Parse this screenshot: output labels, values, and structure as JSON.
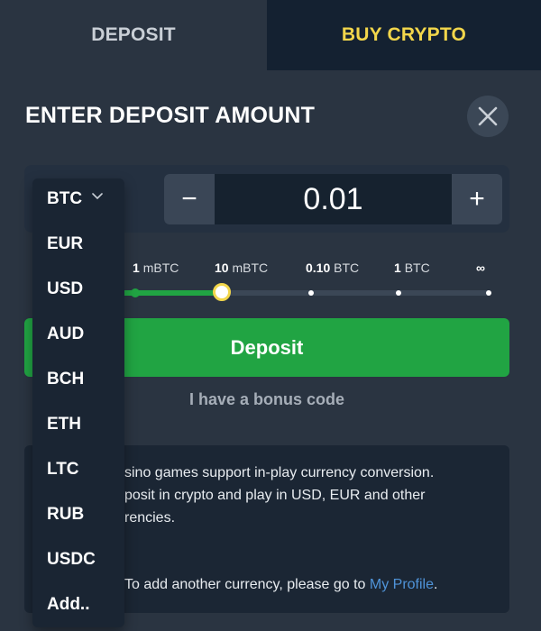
{
  "tabs": {
    "deposit": "DEPOSIT",
    "buy_crypto": "BUY CRYPTO"
  },
  "title": "ENTER DEPOSIT AMOUNT",
  "amount": {
    "value": "0.01",
    "minus": "−",
    "plus": "+"
  },
  "currency_dropdown": {
    "selected": "BTC",
    "options": [
      "EUR",
      "USD",
      "AUD",
      "BCH",
      "ETH",
      "LTC",
      "RUB",
      "USDC",
      "Add.."
    ]
  },
  "slider": {
    "labels": [
      {
        "num": "1",
        "unit": "mBTC"
      },
      {
        "num": "10",
        "unit": "mBTC"
      },
      {
        "num": "0.10",
        "unit": "BTC"
      },
      {
        "num": "1",
        "unit": "BTC"
      },
      {
        "num": "∞",
        "unit": ""
      }
    ],
    "selected_index": 1
  },
  "deposit_button": "Deposit",
  "bonus_link": "I have a bonus code",
  "info": {
    "line1": "sino games support in-play currency conversion.",
    "line2": "posit in crypto and play in USD, EUR and other",
    "line3": "rencies.",
    "line4_prefix": "To add another currency, please go to ",
    "line4_link": "My Profile",
    "line4_suffix": "."
  },
  "colors": {
    "background": "#2a3441",
    "accent_green": "#21a443",
    "accent_yellow": "#f2d64b",
    "link_blue": "#4f93d8"
  }
}
